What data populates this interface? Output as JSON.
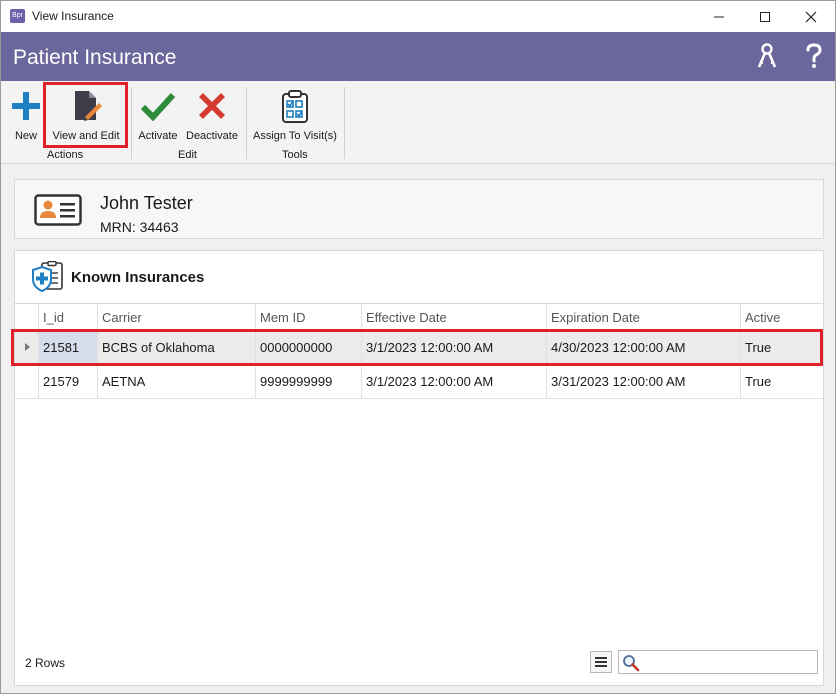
{
  "window": {
    "title": "View Insurance",
    "app_icon_text": "Bpr"
  },
  "header": {
    "title": "Patient Insurance"
  },
  "ribbon": {
    "groups": [
      {
        "label": "Actions"
      },
      {
        "label": "Edit"
      },
      {
        "label": "Tools"
      }
    ],
    "buttons": {
      "new": "New",
      "view_edit": "View and Edit",
      "activate": "Activate",
      "deactivate": "Deactivate",
      "assign": "Assign To Visit(s)"
    }
  },
  "patient": {
    "name": "John Tester",
    "mrn": "MRN: 34463"
  },
  "insurances": {
    "title": "Known Insurances",
    "columns": [
      "I_id",
      "Carrier",
      "Mem ID",
      "Effective Date",
      "Expiration Date",
      "Active"
    ],
    "rows": [
      {
        "id": "21581",
        "carrier": "BCBS of Oklahoma",
        "mem_id": "0000000000",
        "effective": "3/1/2023 12:00:00 AM",
        "expiration": "4/30/2023 12:00:00 AM",
        "active": "True"
      },
      {
        "id": "21579",
        "carrier": "AETNA",
        "mem_id": "9999999999",
        "effective": "3/1/2023 12:00:00 AM",
        "expiration": "3/31/2023 12:00:00 AM",
        "active": "True"
      }
    ],
    "row_count": "2 Rows",
    "search_placeholder": ""
  },
  "colors": {
    "header_bg": "#6b669c",
    "highlight": "#e0202a",
    "accent_blue": "#1e7fc2",
    "accent_green": "#2e8b3a",
    "accent_red": "#d43a2f"
  },
  "icons": {
    "new": "plus-icon",
    "view_edit": "edit-document-icon",
    "activate": "checkmark-icon",
    "deactivate": "x-icon",
    "assign": "clipboard-checklist-icon",
    "patient": "id-card-icon",
    "insurance": "shield-medical-icon",
    "help": "question-icon",
    "keys": "keys-icon",
    "search": "search-icon",
    "menu": "menu-icon"
  }
}
